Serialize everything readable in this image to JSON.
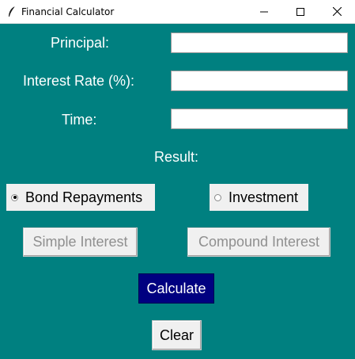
{
  "window": {
    "title": "Financial Calculator",
    "icon": "feather-icon",
    "controls": [
      "minimize-icon",
      "maximize-icon",
      "close-icon"
    ]
  },
  "form": {
    "principal_label": "Principal:",
    "principal_value": "",
    "rate_label": "Interest Rate (%):",
    "rate_value": "",
    "time_label": "Time:",
    "time_value": "",
    "result_label": "Result:"
  },
  "options": {
    "bond_label": "Bond Repayments",
    "investment_label": "Investment",
    "selected": "Bond Repayments"
  },
  "buttons": {
    "simple": "Simple Interest",
    "compound": "Compound Interest",
    "calculate": "Calculate",
    "clear": "Clear"
  },
  "colors": {
    "background": "#008080",
    "calculate_button": "#000080"
  }
}
